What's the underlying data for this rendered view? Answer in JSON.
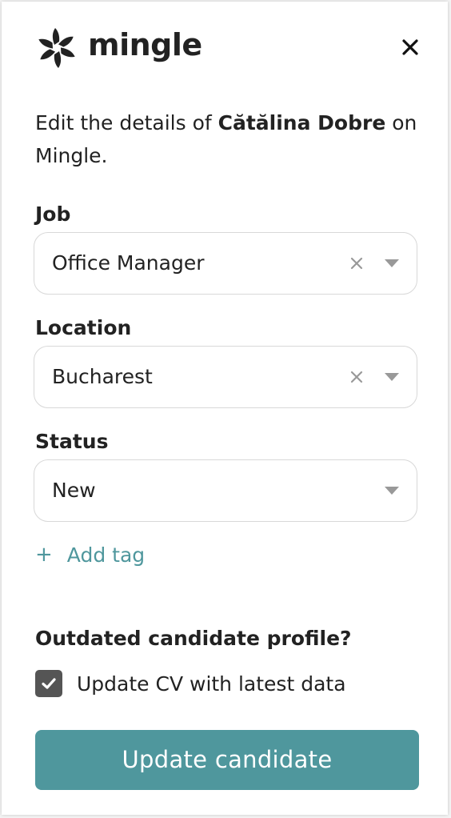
{
  "brand": {
    "name": "mingle",
    "accent_color": "#4f979d",
    "logo_icon": "mingle-pinwheel-logo"
  },
  "header": {
    "close_icon": "close-icon"
  },
  "intro": {
    "prefix": "Edit the details of ",
    "candidate_name": "Cătălina Dobre",
    "suffix": " on Mingle."
  },
  "fields": {
    "job": {
      "label": "Job",
      "value": "Office Manager",
      "clearable": true
    },
    "location": {
      "label": "Location",
      "value": "Bucharest",
      "clearable": true
    },
    "status": {
      "label": "Status",
      "value": "New",
      "clearable": false
    }
  },
  "add_tag": {
    "plus": "+",
    "label": "Add tag"
  },
  "outdated": {
    "heading": "Outdated candidate profile?",
    "checkbox_label": "Update CV with latest data",
    "checked": true
  },
  "submit": {
    "label": "Update candidate"
  }
}
